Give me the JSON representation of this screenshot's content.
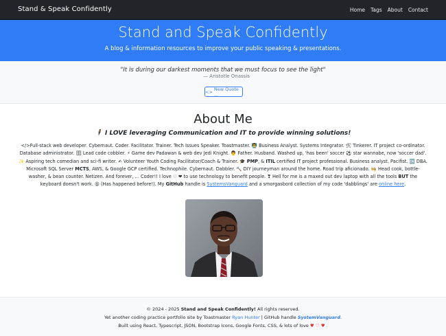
{
  "navbar": {
    "brand": "Stand & Speak Confidently",
    "links": [
      "Home",
      "Tags",
      "About",
      "Contact"
    ]
  },
  "hero": {
    "title": "Stand and Speak Confidently",
    "subtitle": "A blog & information resources to improve your public speaking & presentations."
  },
  "quote": {
    "text": "\"It is during our darkest moments that we must focus to see the light\"",
    "author": "— Aristotle Onassis",
    "button_icon": "<>",
    "button_label": "New Quote ..."
  },
  "about": {
    "title": "About Me",
    "tagline_prefix": "🕴",
    "tagline_i": "I",
    "tagline_love": "LOVE",
    "tagline_rest": "leveraging Communication and IT to provide winning solutions!",
    "bio": {
      "p1": "</>Full-stack web developer. Cybernaut. Coder. Facilitator. Trainer. Tech Issues Speaker. Toastmaster. 👨‍🏫 Business Analyst. Systems Integrator. 🛠 Tinkerer. IT project co-ordinator. Database administrator. 🗄 Lead code cobbler. ⚡ Game dev Padawan & web dev Jedi Knight. 👨 Father. Husband. Washed up, 'has been' soccer ⚽ star wannabe, now 'soccer dad'. ✨ Aspiring tech comedian and sci-fi writer. ✍ Volunteer Youth Coding Facilitator/Coach & Trainer. 🎓",
      "pmp": "PMP",
      "p2": ", &",
      "itil": "ITIL",
      "p3": "certified IT project professional. Business analyst. Pacifist. 🆗 DBA. Microsoft SQL Server",
      "mcts": "MCTS",
      "p4": ", AWS, & Google GCP certified. Technophile. Cybernaut. Dabbler. 🔨 DIY journeyman around the home. Road trip aficionado. 🧑‍🍳 Head cook, bottle-washer, & bean counter. Netizen. And forever, ... Coder!! I love ♡ ❤ to use technology to benefit people. ❣ Hell for me is a maxed out dev laptop with all the tools",
      "but": "BUT",
      "p5": "the keyboard doesn't work. 😩 (Has happened before!). My",
      "github": "GitHub",
      "p6": "handle is",
      "handle_link": "SystemsVanguard",
      "p7": "and a smorgasbord collection of my code 'dabblings' are",
      "online_link": "online here",
      "p8": "."
    }
  },
  "footer": {
    "copyright_prefix": "© 2024 - 2025",
    "site_name": "Stand and Speak Confidently!",
    "rights": "All rights reserved.",
    "line2_prefix": "Yet another coding practice portfolio site by Toastmaster",
    "author": "Ryan Hunter",
    "line2_mid": "| GitHub handle",
    "handle": "SystemVanguard",
    "line2_end": ".",
    "line3": "Built using React, Typescript, JSON, Bootstrap Icons, Google Fonts, CSS, & lots of love",
    "hearts": "♥ ♡ ♥ ."
  },
  "colors": {
    "navbar": "#212529",
    "hero": "#2f7cf6",
    "link": "#2f7cf6"
  }
}
